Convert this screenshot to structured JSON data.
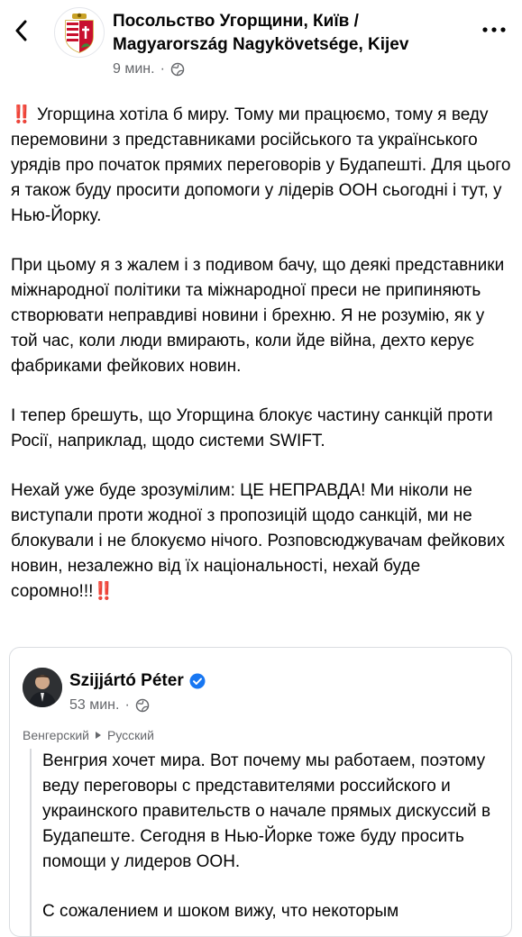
{
  "header": {
    "title": "Посольство Угорщини, Київ / Magyarország Nagykövetsége, Kijev",
    "time": "9 мин.",
    "visibility_icon": "globe-icon",
    "back_icon": "chevron-left-icon",
    "more_icon": "more-horizontal-icon"
  },
  "post": {
    "paragraphs": [
      {
        "prefix": "‼️",
        "text": " Угорщина хотіла б миру. Тому ми працюємо, тому я веду перемовини з представниками російського та українського урядів про початок прямих переговорів у Будапешті. Для цього я також буду просити допомоги у лідерів ООН сьогодні і тут, у Нью-Йорку."
      },
      {
        "text": "При цьому я з жалем і з подивом бачу, що деякі представники міжнародної політики та міжнародної преси не припиняють створювати неправдиві новини і брехню. Я не розумію, як у той час, коли люди вмирають, коли йде війна, дехто керує фабриками фейкових новин."
      },
      {
        "text": "І тепер брешуть, що Угорщина блокує частину санкцій проти Росії, наприклад, щодо системи SWIFT."
      },
      {
        "text": "Нехай уже буде зрозумілим: ЦЕ НЕПРАВДА! Ми ніколи не виступали проти жодної з пропозицій щодо санкцій, ми не блокували і не блокуємо нічого. Розповсюджувачам фейкових новин, незалежно від їх національності, нехай буде соромно!!!",
        "suffix": "‼️"
      }
    ]
  },
  "shared": {
    "author": "Szijjártó Péter",
    "verified_icon": "verified-badge-icon",
    "time": "53 мин.",
    "visibility_icon": "globe-icon",
    "translate_from": "Венгерский",
    "translate_to": "Русский",
    "paragraphs": [
      "Венгрия хочет мира. Вот почему мы работаем, поэтому веду переговоры с представителями российского и украинского правительств о начале прямых дискуссий в Будапеште. Сегодня в Нью-Йорке тоже буду просить помощи у лидеров ООН.",
      "С сожалением и шоком вижу, что некоторым"
    ]
  },
  "colors": {
    "accent": "#1877f2",
    "secondary_text": "#65676b",
    "alert": "#e02f2f"
  }
}
